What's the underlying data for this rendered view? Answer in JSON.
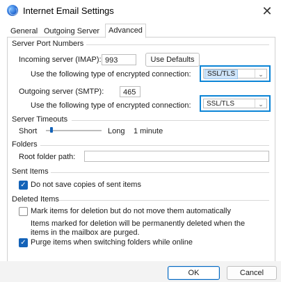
{
  "window": {
    "title": "Internet Email Settings",
    "icon": "internet-email-globe-icon",
    "close_glyph": "✕"
  },
  "tabs": [
    {
      "label": "General",
      "active": false
    },
    {
      "label": "Outgoing Server",
      "active": false
    },
    {
      "label": "Advanced",
      "active": true
    }
  ],
  "server_port_numbers": {
    "heading": "Server Port Numbers",
    "incoming_label": "Incoming server (IMAP):",
    "incoming_value": "993",
    "use_defaults_label": "Use Defaults",
    "encryption_label": "Use the following type of encrypted connection:",
    "incoming_encryption": "SSL/TLS",
    "outgoing_label": "Outgoing server (SMTP):",
    "outgoing_value": "465",
    "outgoing_encryption": "SSL/TLS"
  },
  "server_timeouts": {
    "heading": "Server Timeouts",
    "short_label": "Short",
    "long_label": "Long",
    "value_text": "1 minute",
    "level_fraction": 0.1
  },
  "folders": {
    "heading": "Folders",
    "root_folder_label": "Root folder path:",
    "root_folder_value": ""
  },
  "sent_items": {
    "heading": "Sent Items",
    "do_not_save_label": "Do not save copies of sent items",
    "do_not_save_checked": true
  },
  "deleted_items": {
    "heading": "Deleted Items",
    "mark_label": "Mark items for deletion but do not move them automatically",
    "mark_checked": false,
    "note_line1": "Items marked for deletion will be permanently deleted when the",
    "note_line2": "items in the mailbox are purged.",
    "purge_label": "Purge items when switching folders while online",
    "purge_checked": true
  },
  "buttons": {
    "ok": "OK",
    "cancel": "Cancel"
  },
  "colors": {
    "accent": "#0067c0",
    "highlight_border": "#0a84d6",
    "checkbox_checked": "#1463b8"
  }
}
